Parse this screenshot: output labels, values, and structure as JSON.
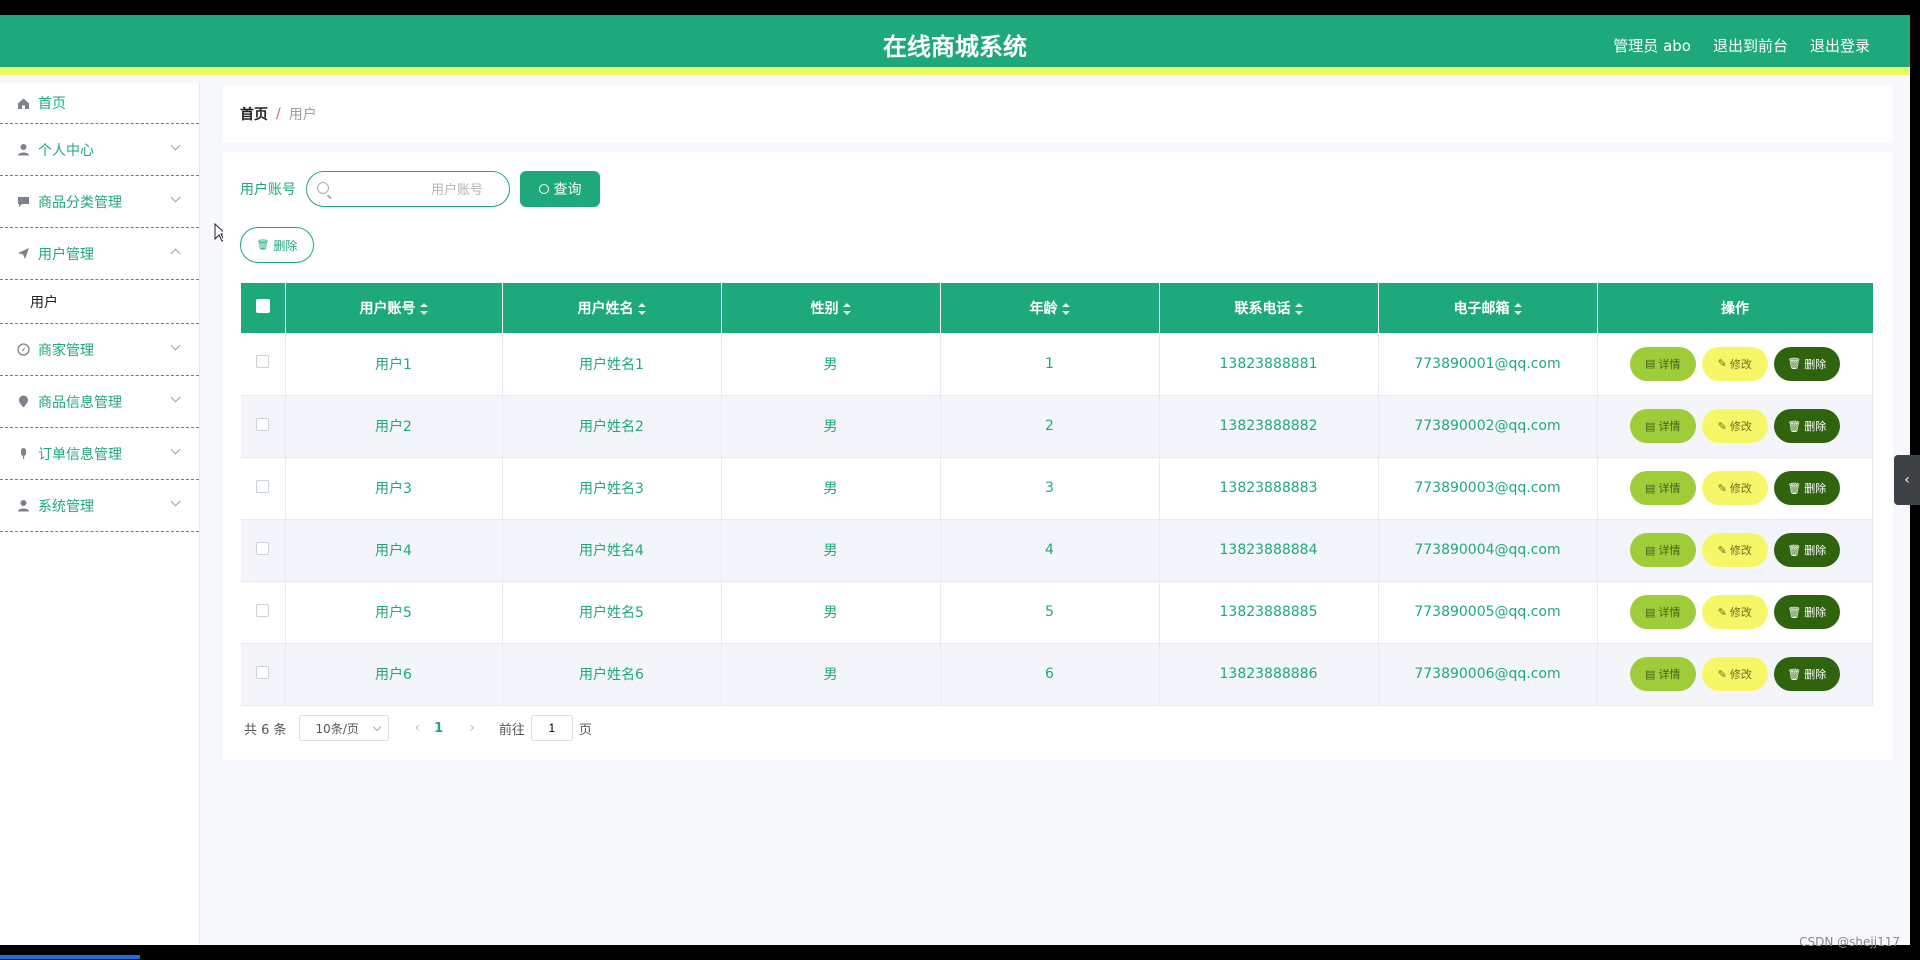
{
  "header": {
    "title": "在线商城系统",
    "admin_label": "管理员 abo",
    "to_front_label": "退出到前台",
    "logout_label": "退出登录"
  },
  "sidebar": {
    "items": [
      {
        "label": "首页",
        "icon": "home-icon"
      },
      {
        "label": "个人中心",
        "icon": "user-icon"
      },
      {
        "label": "商品分类管理",
        "icon": "chat-icon"
      },
      {
        "label": "用户管理",
        "icon": "send-icon"
      },
      {
        "label": "商家管理",
        "icon": "compass-icon"
      },
      {
        "label": "商品信息管理",
        "icon": "location-icon"
      },
      {
        "label": "订单信息管理",
        "icon": "microphone-icon"
      },
      {
        "label": "系统管理",
        "icon": "user-icon"
      }
    ],
    "sub_item": "用户"
  },
  "breadcrumb": {
    "home": "首页",
    "separator": "/",
    "current": "用户"
  },
  "search": {
    "label": "用户账号",
    "placeholder": "用户账号",
    "button": "查询"
  },
  "toolbar": {
    "delete_label": "删除"
  },
  "table": {
    "headers": [
      "用户账号",
      "用户姓名",
      "性别",
      "年龄",
      "联系电话",
      "电子邮箱",
      "操作"
    ],
    "rows": [
      {
        "account": "用户1",
        "name": "用户姓名1",
        "gender": "男",
        "age": "1",
        "phone": "13823888881",
        "email": "773890001@qq.com"
      },
      {
        "account": "用户2",
        "name": "用户姓名2",
        "gender": "男",
        "age": "2",
        "phone": "13823888882",
        "email": "773890002@qq.com"
      },
      {
        "account": "用户3",
        "name": "用户姓名3",
        "gender": "男",
        "age": "3",
        "phone": "13823888883",
        "email": "773890003@qq.com"
      },
      {
        "account": "用户4",
        "name": "用户姓名4",
        "gender": "男",
        "age": "4",
        "phone": "13823888884",
        "email": "773890004@qq.com"
      },
      {
        "account": "用户5",
        "name": "用户姓名5",
        "gender": "男",
        "age": "5",
        "phone": "13823888885",
        "email": "773890005@qq.com"
      },
      {
        "account": "用户6",
        "name": "用户姓名6",
        "gender": "男",
        "age": "6",
        "phone": "13823888886",
        "email": "773890006@qq.com"
      }
    ],
    "actions": {
      "detail": "详情",
      "edit": "修改",
      "delete": "删除"
    }
  },
  "pagination": {
    "total": "共 6 条",
    "page_size": "10条/页",
    "current_page": "1",
    "goto_label": "前往",
    "goto_value": "1",
    "page_suffix": "页"
  },
  "watermark": "CSDN @shejj117",
  "colors": {
    "primary": "#1ea97c",
    "accent_bar": "#ecfb60",
    "detail_button": "#9fcd3a",
    "edit_button": "#f6f766",
    "delete_button": "#30630d"
  }
}
